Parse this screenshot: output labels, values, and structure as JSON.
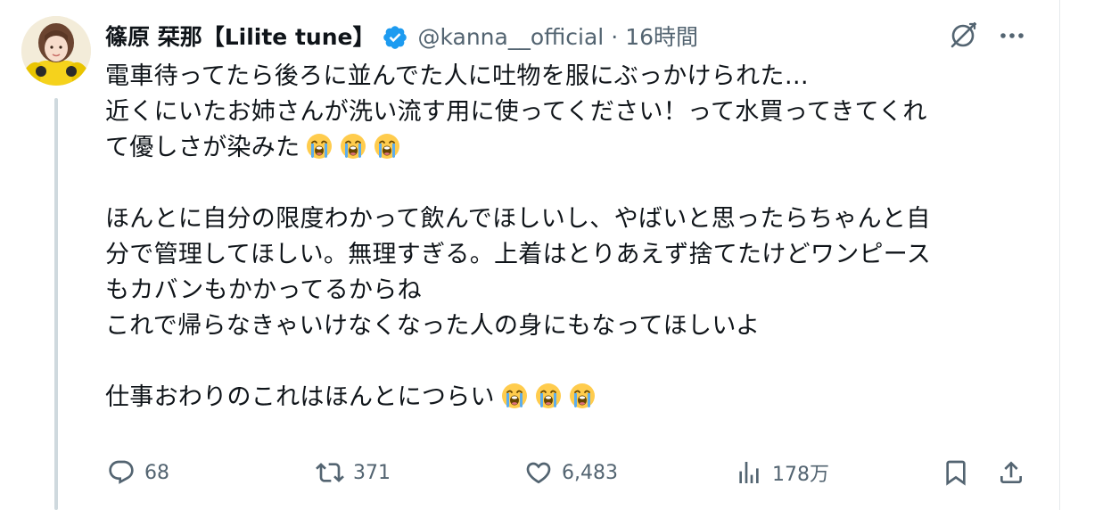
{
  "tweet": {
    "author": {
      "display_name": "篠原 栞那【Lilite tune】",
      "handle": "@kanna__official",
      "separator": "·",
      "time": "16時間",
      "verified_color": "#1d9bf0"
    },
    "body_lines": [
      "電車待ってたら後ろに並んでた人に吐物を服にぶっかけられた…",
      "近くにいたお姉さんが洗い流す用に使ってください！って水買ってきてくれ",
      "て優しさが染みた",
      "",
      "ほんとに自分の限度わかって飲んでほしいし、やばいと思ったらちゃんと自",
      "分で管理してほしい。無理すぎる。上着はとりあえず捨てたけどワンピース",
      "もカバンもかかってるからね",
      "これで帰らなきゃいけなくなった人の身にもなってほしいよ",
      "",
      "仕事おわりのこれはほんとにつらい"
    ],
    "emoji_name": "loudly-crying-face-emoji",
    "actions": {
      "replies": "68",
      "retweets": "371",
      "likes": "6,483",
      "views": "178万"
    },
    "icons": {
      "grok": "grok-icon",
      "more": "more-icon",
      "reply": "reply-icon",
      "retweet": "retweet-icon",
      "like": "heart-icon",
      "views": "views-icon",
      "bookmark": "bookmark-icon",
      "share": "share-icon"
    },
    "colors": {
      "text": "#0f1419",
      "secondary": "#536471",
      "thread_line": "#cfd9de"
    }
  }
}
